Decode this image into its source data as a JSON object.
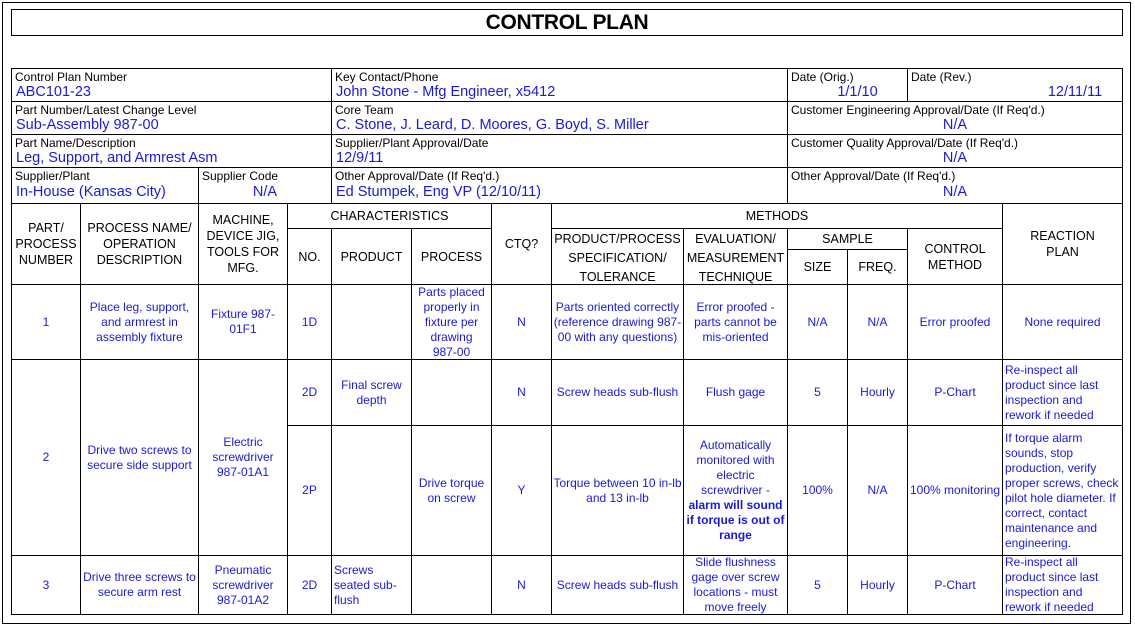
{
  "title": "CONTROL PLAN",
  "header": {
    "control_plan_number": {
      "label": "Control Plan Number",
      "value": "ABC101-23"
    },
    "key_contact": {
      "label": "Key Contact/Phone",
      "value": "John Stone - Mfg Engineer, x5412"
    },
    "date_orig": {
      "label": "Date (Orig.)",
      "value": "1/1/10"
    },
    "date_rev": {
      "label": "Date (Rev.)",
      "value": "12/11/11"
    },
    "part_number": {
      "label": "Part Number/Latest Change Level",
      "value": "Sub-Assembly 987-00"
    },
    "core_team": {
      "label": "Core Team",
      "value": "C. Stone, J. Leard, D. Moores, G. Boyd, S. Miller"
    },
    "customer_eng_approval": {
      "label": "Customer Engineering Approval/Date (If Req'd.)",
      "value": "N/A"
    },
    "part_name": {
      "label": "Part Name/Description",
      "value": "Leg, Support, and Armrest Asm"
    },
    "supplier_plant_approval": {
      "label": "Supplier/Plant Approval/Date",
      "value": "12/9/11"
    },
    "customer_quality_approval": {
      "label": "Customer Quality Approval/Date (If Req'd.)",
      "value": "N/A"
    },
    "supplier_plant": {
      "label": "Supplier/Plant",
      "value": "In-House (Kansas City)"
    },
    "supplier_code": {
      "label": "Supplier Code",
      "value": "N/A"
    },
    "other_approval_1": {
      "label": "Other Approval/Date (If Req'd.)",
      "value": "Ed Stumpek, Eng VP (12/10/11)"
    },
    "other_approval_2": {
      "label": "Other Approval/Date (If Req'd.)",
      "value": "N/A"
    }
  },
  "columns": {
    "part_process_number": "PART/ PROCESS NUMBER",
    "process_name": "PROCESS NAME/ OPERATION DESCRIPTION",
    "machine": "MACHINE, DEVICE JIG, TOOLS FOR MFG.",
    "characteristics": "CHARACTERISTICS",
    "no": "NO.",
    "product": "PRODUCT",
    "process": "PROCESS",
    "ctq": "CTQ?",
    "methods": "METHODS",
    "specification": "PRODUCT/PROCESS SPECIFICATION/ TOLERANCE",
    "evaluation": "EVALUATION/ MEASUREMENT TECHNIQUE",
    "sample": "SAMPLE",
    "size": "SIZE",
    "freq": "FREQ.",
    "control_method": "CONTROL METHOD",
    "reaction_plan": "REACTION PLAN"
  },
  "rows": [
    {
      "part_number": "1",
      "process_name": "Place leg, support, and armrest in assembly fixture",
      "machine": "Fixture 987-01F1",
      "no": "1D",
      "product": "",
      "process": "Parts placed properly in fixture per drawing 987-00",
      "ctq": "N",
      "specification": "Parts oriented correctly (reference drawing 987-00 with any questions)",
      "evaluation": "Error proofed - parts cannot be mis-oriented",
      "evaluation_bold": "",
      "size": "N/A",
      "freq": "N/A",
      "control_method": "Error proofed",
      "reaction_plan": "None required"
    },
    {
      "part_number": "2",
      "process_name": "Drive two screws to secure side support",
      "machine": "Electric screwdriver 987-01A1",
      "no": "2D",
      "product": "Final screw depth",
      "process": "",
      "ctq": "N",
      "specification": "Screw heads sub-flush",
      "evaluation": "Flush gage",
      "evaluation_bold": "",
      "size": "5",
      "freq": "Hourly",
      "control_method": "P-Chart",
      "reaction_plan": "Re-inspect all product since last inspection and rework if needed"
    },
    {
      "part_number": "",
      "process_name": "",
      "machine": "",
      "no": "2P",
      "product": "",
      "process": "Drive torque on screw",
      "ctq": "Y",
      "specification": "Torque between 10 in-lb and 13 in-lb",
      "evaluation": "Automatically monitored with electric screwdriver - ",
      "evaluation_bold": "alarm will sound if torque is out of range",
      "size": "100%",
      "freq": "N/A",
      "control_method": "100% monitoring",
      "reaction_plan": "If torque alarm sounds, stop production, verify proper screws, check pilot hole diameter.  If correct, contact maintenance and engineering."
    },
    {
      "part_number": "3",
      "process_name": "Drive three screws to secure arm rest",
      "machine": "Pneumatic screwdriver 987-01A2",
      "no": "2D",
      "product": "Screws seated sub-flush",
      "process": "",
      "ctq": "N",
      "specification": "Screw heads sub-flush",
      "evaluation": "Slide flushness gage over screw locations - must move freely",
      "evaluation_bold": "",
      "size": "5",
      "freq": "Hourly",
      "control_method": "P-Chart",
      "reaction_plan": "Re-inspect all product since last inspection and rework if needed"
    }
  ],
  "colors": {
    "value_text": "#1a1ad6",
    "label_text": "#000000",
    "border": "#000000"
  }
}
